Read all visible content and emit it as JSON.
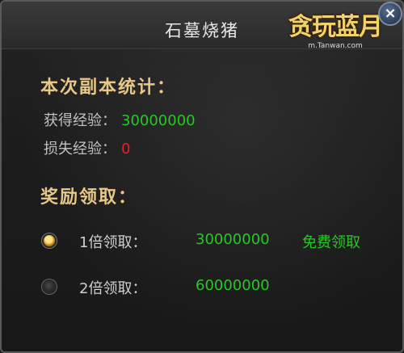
{
  "window": {
    "title": "石墓烧猪",
    "close_icon": "close-icon"
  },
  "logo": {
    "text": "贪玩蓝月",
    "url": "m.Tanwan.com"
  },
  "stats": {
    "heading": "本次副本统计：",
    "exp_gained_label": "获得经验：",
    "exp_gained_value": "30000000",
    "exp_lost_label": "损失经验：",
    "exp_lost_value": "0"
  },
  "rewards": {
    "heading": "奖励领取：",
    "options": [
      {
        "label": "1倍领取：",
        "value": "30000000",
        "action": "免费领取",
        "selected": true
      },
      {
        "label": "2倍领取：",
        "value": "60000000",
        "action": "",
        "selected": false
      }
    ]
  },
  "colors": {
    "heading": "#e8c888",
    "value_green": "#26c826",
    "value_red": "#e52020",
    "label_gray": "#c0c0c0"
  }
}
